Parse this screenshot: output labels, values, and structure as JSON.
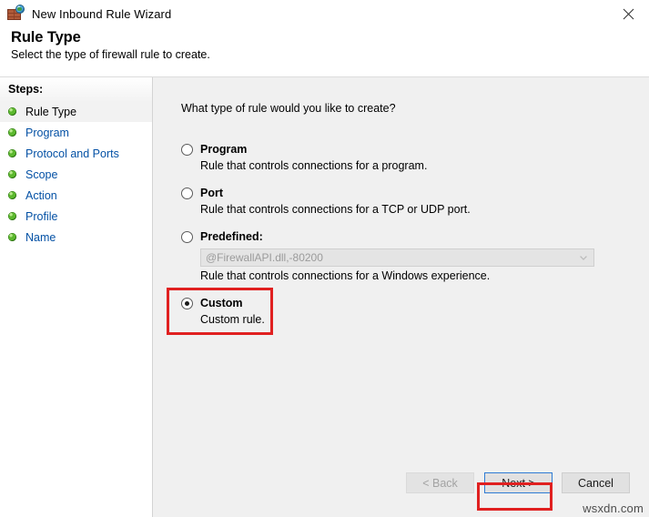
{
  "window": {
    "title": "New Inbound Rule Wizard",
    "icon": "firewall-globe-icon",
    "close_label": "✕"
  },
  "header": {
    "title": "Rule Type",
    "subtitle": "Select the type of firewall rule to create."
  },
  "sidebar": {
    "heading": "Steps:",
    "items": [
      {
        "label": "Rule Type",
        "current": true
      },
      {
        "label": "Program",
        "current": false
      },
      {
        "label": "Protocol and Ports",
        "current": false
      },
      {
        "label": "Scope",
        "current": false
      },
      {
        "label": "Action",
        "current": false
      },
      {
        "label": "Profile",
        "current": false
      },
      {
        "label": "Name",
        "current": false
      }
    ]
  },
  "main": {
    "question": "What type of rule would you like to create?",
    "options": [
      {
        "title": "Program",
        "description": "Rule that controls connections for a program.",
        "selected": false
      },
      {
        "title": "Port",
        "description": "Rule that controls connections for a TCP or UDP port.",
        "selected": false
      },
      {
        "title": "Predefined:",
        "description": "Rule that controls connections for a Windows experience.",
        "selected": false,
        "combo_value": "@FirewallAPI.dll,-80200",
        "combo_disabled": true
      },
      {
        "title": "Custom",
        "description": "Custom rule.",
        "selected": true,
        "highlighted": true
      }
    ]
  },
  "footer": {
    "back_label": "< Back",
    "back_disabled": true,
    "next_label": "Next >",
    "next_focused": true,
    "next_highlighted": true,
    "cancel_label": "Cancel"
  },
  "watermark": "wsxdn.com",
  "colors": {
    "accent_link": "#0451a5",
    "annotation_red": "#e02020",
    "focus_blue": "#2f7cd4",
    "content_bg": "#f0f0f0",
    "step_bullet_green": "#5cb82e"
  }
}
